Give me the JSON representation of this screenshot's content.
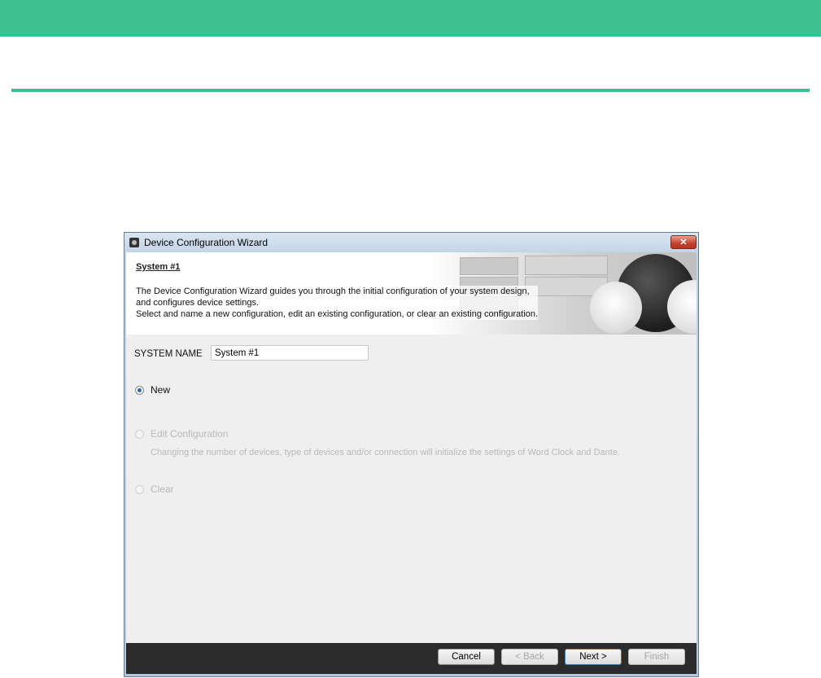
{
  "colors": {
    "accent": "#3dbf92",
    "footer": "#2b2b2b",
    "disabled_text": "#b8b8b8"
  },
  "window": {
    "title": "Device Configuration Wizard",
    "close_label": "✕"
  },
  "header": {
    "title": "System #1",
    "description": [
      "The Device Configuration Wizard guides you through the initial configuration of your system design,",
      "and configures device settings.",
      "Select and name a new configuration, edit an existing configuration, or clear an existing configuration."
    ]
  },
  "form": {
    "system_name_label": "SYSTEM NAME",
    "system_name_value": "System #1",
    "options": [
      {
        "label": "New",
        "selected": true,
        "enabled": true
      },
      {
        "label": "Edit Configuration",
        "selected": false,
        "enabled": false
      },
      {
        "label": "Clear",
        "selected": false,
        "enabled": false
      }
    ],
    "edit_note": "Changing the number of devices, type of devices and/or connection will initialize the settings of Word Clock and Dante."
  },
  "buttons": {
    "cancel": "Cancel",
    "back": "< Back",
    "next": "Next >",
    "finish": "Finish"
  }
}
